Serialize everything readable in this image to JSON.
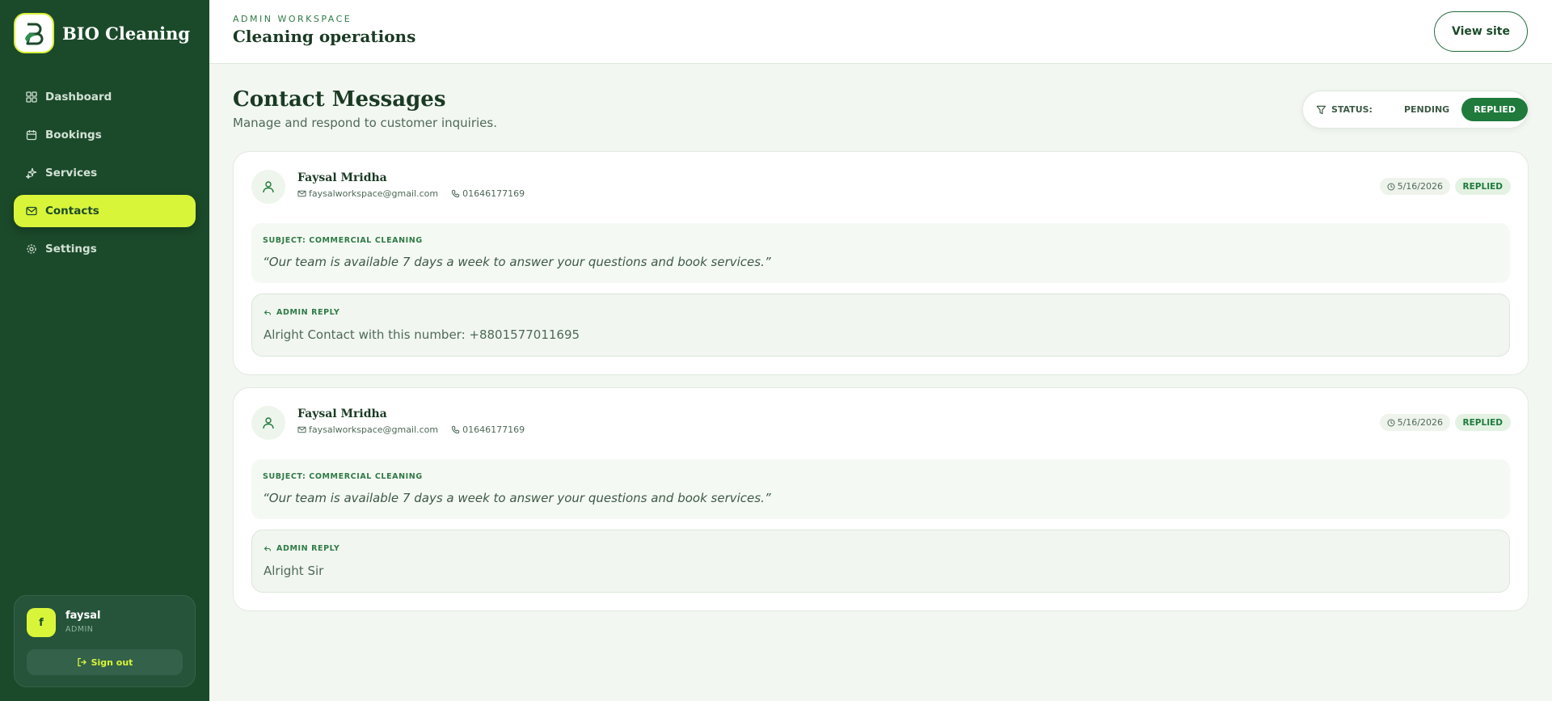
{
  "brand": {
    "name": "BIO Cleaning"
  },
  "sidebar": {
    "items": [
      {
        "label": "Dashboard",
        "icon": "dashboard-icon"
      },
      {
        "label": "Bookings",
        "icon": "calendar-icon"
      },
      {
        "label": "Services",
        "icon": "sparkles-icon"
      },
      {
        "label": "Contacts",
        "icon": "mail-icon",
        "active": true
      },
      {
        "label": "Settings",
        "icon": "gear-icon"
      }
    ]
  },
  "user": {
    "initial": "f",
    "name": "faysal",
    "role": "ADMIN",
    "signout_label": "Sign out"
  },
  "header": {
    "workspace_label": "ADMIN WORKSPACE",
    "title": "Cleaning operations",
    "view_site_label": "View site"
  },
  "page": {
    "title": "Contact Messages",
    "subtitle": "Manage and respond to customer inquiries."
  },
  "filter": {
    "label": "STATUS:",
    "options": [
      {
        "label": "PENDING"
      },
      {
        "label": "REPLIED",
        "active": true
      }
    ]
  },
  "messages": [
    {
      "name": "Faysal Mridha",
      "email": "faysalworkspace@gmail.com",
      "phone": "01646177169",
      "date": "5/16/2026",
      "status": "REPLIED",
      "subject": "SUBJECT: COMMERCIAL CLEANING",
      "message": "“Our team is available 7 days a week to answer your questions and book services.”",
      "reply_label": "ADMIN REPLY",
      "reply": "Alright Contact with this number: +8801577011695"
    },
    {
      "name": "Faysal Mridha",
      "email": "faysalworkspace@gmail.com",
      "phone": "01646177169",
      "date": "5/16/2026",
      "status": "REPLIED",
      "subject": "SUBJECT: COMMERCIAL CLEANING",
      "message": "“Our team is available 7 days a week to answer your questions and book services.”",
      "reply_label": "ADMIN REPLY",
      "reply": "Alright Sir"
    }
  ],
  "colors": {
    "sidebar": "#1b4a2a",
    "accent": "#d9f53a",
    "primary": "#1f7a3c",
    "background": "#f2f7f1"
  }
}
